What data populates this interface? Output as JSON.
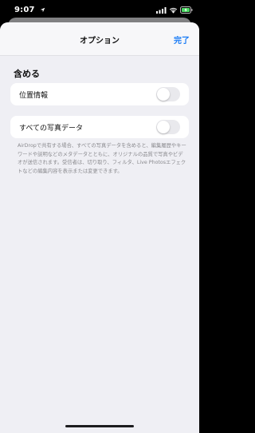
{
  "status_bar": {
    "time": "9:07",
    "battery_color": "#4cd964"
  },
  "nav": {
    "title": "オプション",
    "done_label": "完了"
  },
  "section": {
    "header": "含める"
  },
  "rows": [
    {
      "label": "位置情報",
      "toggle_on": false
    },
    {
      "label": "すべての写真データ",
      "toggle_on": false
    }
  ],
  "footer_note": "AirDropで共有する場合、すべての写真データを含めると、編集履歴やキーワードや説明などのメタデータとともに、オリジナルの品質で写真やビデオが送信されます。受信者は、切り取り、フィルタ、Live Photosエフェクトなどの編集内容を表示または変更できます。",
  "colors": {
    "accent": "#1a7cf5",
    "sheet_bg": "#efeff4"
  }
}
